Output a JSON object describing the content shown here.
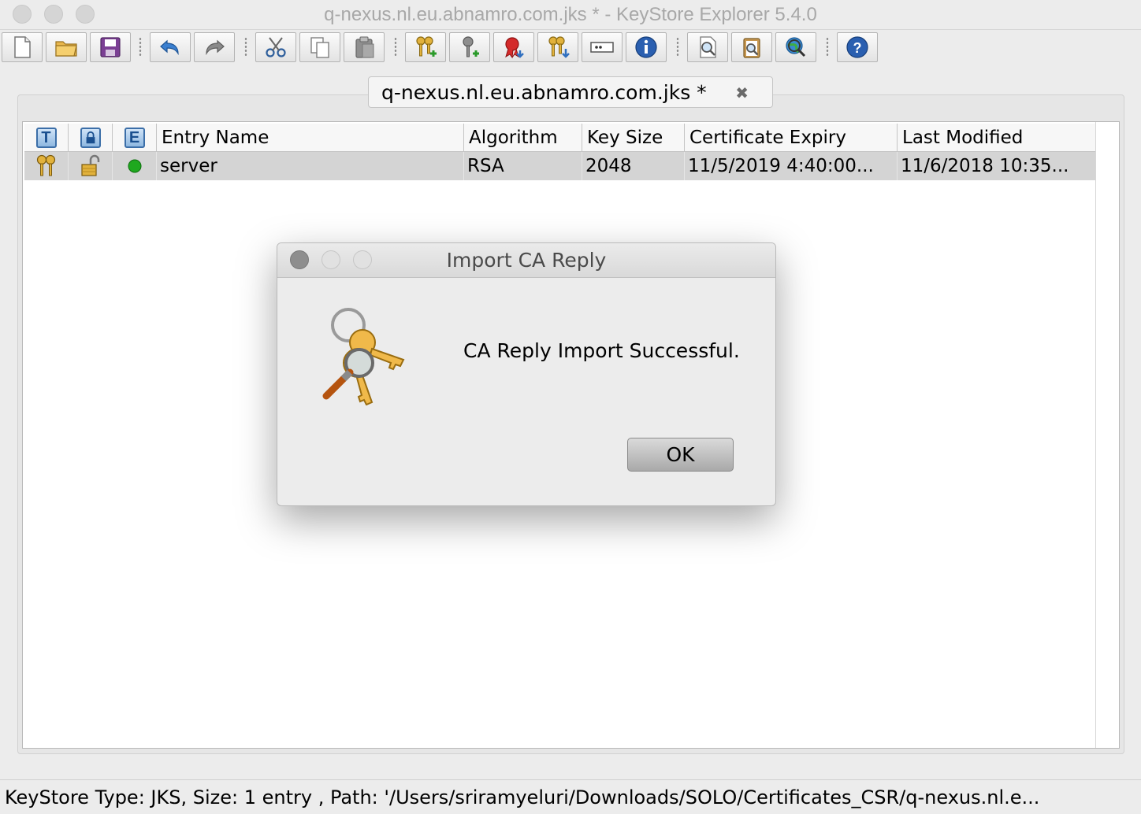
{
  "window": {
    "title": "q-nexus.nl.eu.abnamro.com.jks * - KeyStore Explorer 5.4.0"
  },
  "toolbar": {
    "buttons": [
      {
        "name": "new-keystore",
        "icon": "new-document-icon"
      },
      {
        "name": "open-keystore",
        "icon": "open-folder-icon"
      },
      {
        "name": "save-keystore",
        "icon": "save-disk-icon"
      },
      {
        "name": "undo",
        "icon": "undo-arrow-icon"
      },
      {
        "name": "redo",
        "icon": "redo-arrow-icon"
      },
      {
        "name": "cut",
        "icon": "scissors-icon"
      },
      {
        "name": "copy",
        "icon": "copy-icon"
      },
      {
        "name": "paste",
        "icon": "clipboard-icon"
      },
      {
        "name": "generate-key-pair",
        "icon": "keypair-add-icon"
      },
      {
        "name": "generate-secret-key",
        "icon": "secret-key-icon"
      },
      {
        "name": "import-trusted-certificate",
        "icon": "certificate-ribbon-icon"
      },
      {
        "name": "import-key-pair",
        "icon": "keypair-import-icon"
      },
      {
        "name": "set-password",
        "icon": "password-field-icon"
      },
      {
        "name": "keystore-properties",
        "icon": "info-icon"
      },
      {
        "name": "examine-file",
        "icon": "examine-file-icon"
      },
      {
        "name": "examine-clipboard",
        "icon": "examine-clipboard-icon"
      },
      {
        "name": "examine-ssl",
        "icon": "examine-ssl-globe-icon"
      },
      {
        "name": "help",
        "icon": "help-icon"
      }
    ]
  },
  "tab": {
    "label": "q-nexus.nl.eu.abnamro.com.jks *",
    "close_glyph": "✖"
  },
  "table": {
    "header_icons": {
      "type": "T",
      "lock": "lock",
      "expiry": "E"
    },
    "columns": [
      "Entry Name",
      "Algorithm",
      "Key Size",
      "Certificate Expiry",
      "Last Modified"
    ],
    "rows": [
      {
        "type_icon": "key-pair-icon",
        "lock_icon": "unlocked-padlock-icon",
        "status_icon": "green-status-icon",
        "entry_name": "server",
        "algorithm": "RSA",
        "key_size": "2048",
        "certificate_expiry": "11/5/2019 4:40:00...",
        "last_modified": "11/6/2018 10:35..."
      }
    ]
  },
  "status_bar": {
    "text": "KeyStore Type: JKS, Size: 1 entry , Path: '/Users/sriramyeluri/Downloads/SOLO/Certificates_CSR/q-nexus.nl.e..."
  },
  "dialog": {
    "title": "Import CA Reply",
    "message": "CA Reply Import Successful.",
    "ok_label": "OK",
    "icon": "keys-magnifier-icon"
  },
  "colors": {
    "window_bg": "#ececec",
    "selected_row": "#d4d4d4",
    "status_green": "#1fa81f",
    "header_icon_blue": "#3b6ea8"
  }
}
